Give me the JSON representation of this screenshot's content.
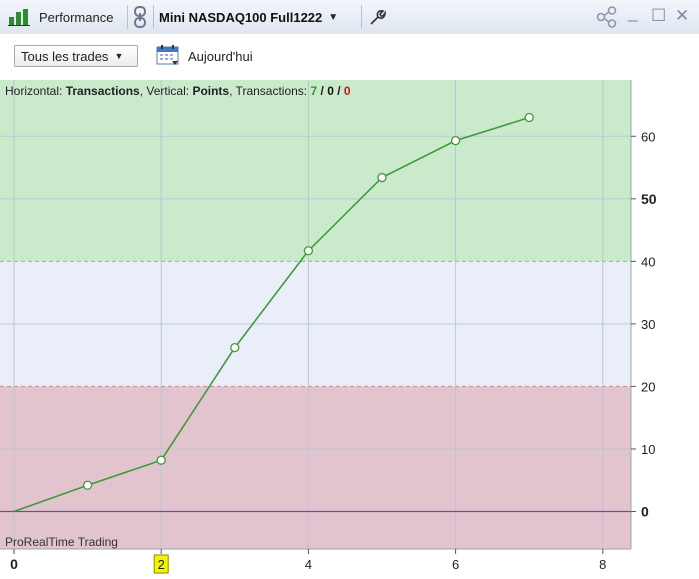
{
  "titlebar": {
    "app_label": "Performance",
    "instrument": "Mini NASDAQ100 Full1222",
    "icons": [
      "bar-chart-icon",
      "link-icon",
      "chevron-down-icon",
      "wrench-icon",
      "share-icon",
      "minimize-icon",
      "maximize-icon",
      "close-icon"
    ],
    "controls": {
      "minimize": "_",
      "maximize": "☐",
      "close": "✕"
    }
  },
  "toolbar": {
    "filter_label": "Tous les trades",
    "today_label": "Aujourd'hui",
    "icons": [
      "calendar-icon"
    ]
  },
  "chart_info": {
    "horizontal_label": "Horizontal:",
    "horizontal_value": "Transactions",
    "vertical_label": ", Vertical:",
    "vertical_value": "Points",
    "transactions_label": ", Transactions:",
    "count_total": "7",
    "slash1": " / ",
    "count_mid": "0",
    "slash2": " / ",
    "count_loss": "0",
    "watermark": "ProRealTime Trading"
  },
  "colors": {
    "zone_top": "#c9ebcc",
    "zone_mid": "#e9eef9",
    "zone_bottom": "#e2c4cf",
    "line": "#3f9a3a",
    "zero_line": "#5d4fb5",
    "count_total": "#2e9a2e",
    "count_mid": "#111111",
    "count_loss": "#c02020",
    "cursor_label_bg": "#f5f500"
  },
  "chart_data": {
    "type": "line",
    "x": [
      0,
      1,
      2,
      3,
      4,
      5,
      6,
      7
    ],
    "series": [
      {
        "values": [
          0,
          4.2,
          8.2,
          26.2,
          41.7,
          53.4,
          59.3,
          63.0
        ]
      }
    ],
    "xlim": [
      0,
      8.5
    ],
    "ylim": [
      -6,
      69
    ],
    "x_ticks": [
      "0",
      "2",
      "4",
      "6",
      "8"
    ],
    "y_ticks": [
      "0",
      "10",
      "20",
      "30",
      "40",
      "50",
      "60"
    ],
    "bold_x_ticks": [
      "0"
    ],
    "bold_y_ticks": [
      "0",
      "50"
    ],
    "highlighted_x_tick": "2",
    "zones": [
      {
        "from": 40,
        "to": 69,
        "color": "green"
      },
      {
        "from": 20,
        "to": 40,
        "color": "light-blue"
      },
      {
        "from": -6,
        "to": 20,
        "color": "pink"
      }
    ],
    "grid": true
  }
}
